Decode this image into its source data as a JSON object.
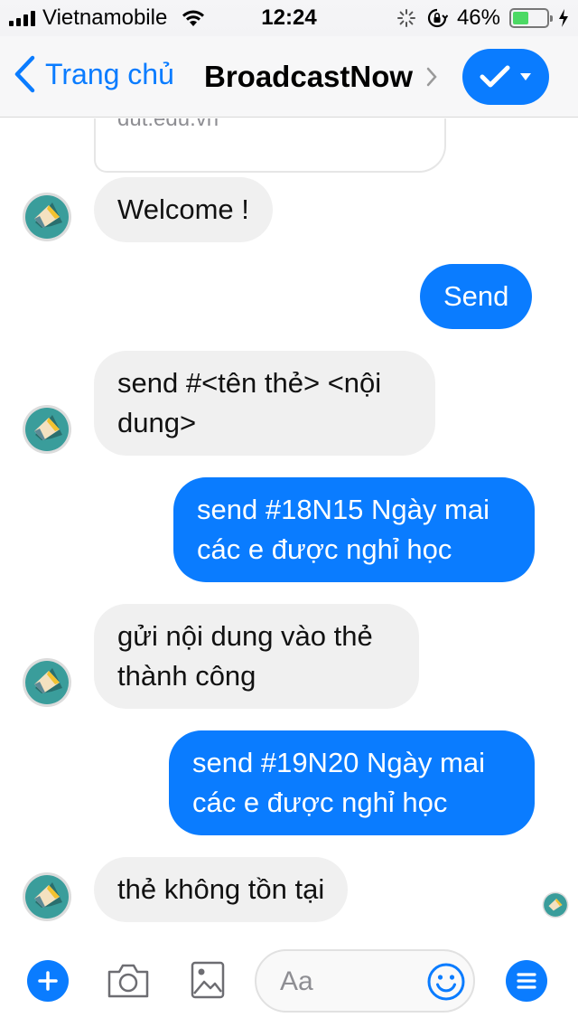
{
  "status_bar": {
    "carrier": "Vietnamobile",
    "time": "12:24",
    "battery": "46%",
    "battery_level": 0.46
  },
  "nav": {
    "back_label": "Trang chủ",
    "title": "BroadcastNow",
    "accent_color": "#0a7cff"
  },
  "chat": {
    "link_card_domain": "dut.edu.vn",
    "messages": [
      {
        "from": "bot",
        "text": "Welcome !"
      },
      {
        "from": "user",
        "text": "Send"
      },
      {
        "from": "bot",
        "lines": [
          "send #<tên thẻ> <nội",
          "dung>"
        ]
      },
      {
        "from": "user",
        "lines": [
          "send #18N15 Ngày mai",
          "các e được nghỉ học"
        ]
      },
      {
        "from": "bot",
        "lines": [
          "gửi nội dung vào thẻ",
          "thành công"
        ]
      },
      {
        "from": "user",
        "lines": [
          "send #19N20 Ngày mai",
          "các e được nghỉ học"
        ]
      },
      {
        "from": "bot",
        "text": "thẻ không tồn tại"
      }
    ]
  },
  "composer": {
    "placeholder": "Aa",
    "icons": [
      "plus-icon",
      "camera-icon",
      "image-icon",
      "emoji-icon",
      "menu-icon"
    ]
  }
}
